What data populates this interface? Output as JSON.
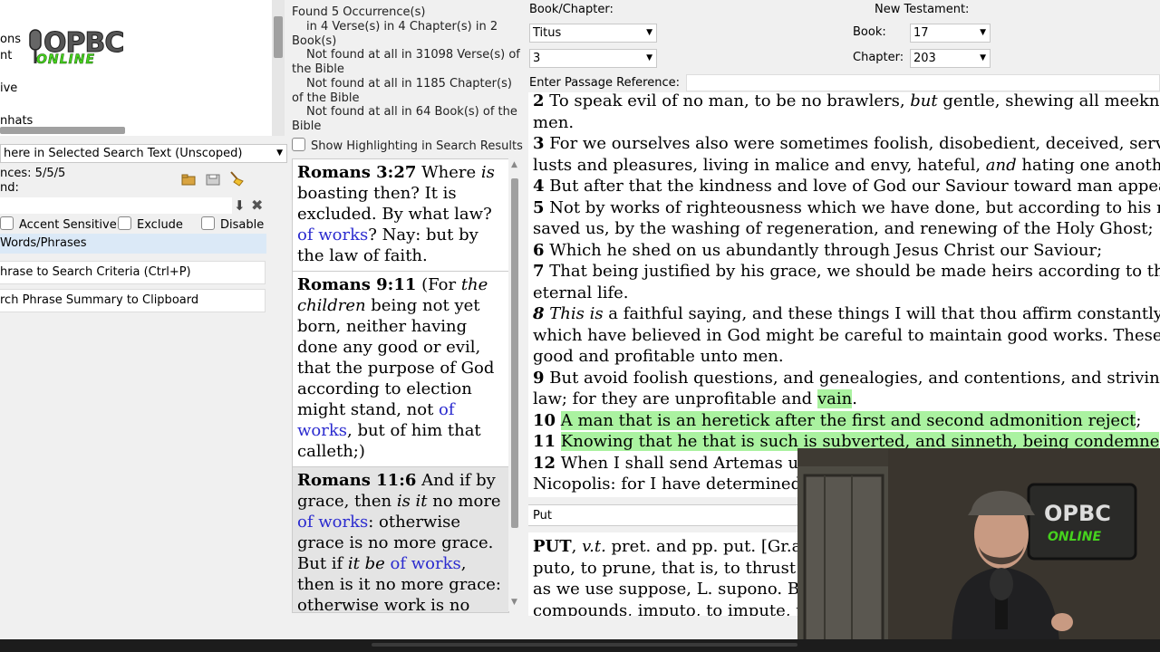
{
  "left_panel": {
    "tree_items": [
      "ons",
      "nt",
      "ive",
      "nhats"
    ],
    "logo": {
      "top": "OPBC",
      "bottom": "ONLINE"
    },
    "scope_select": "here in Selected Search Text (Unscoped)",
    "occurrences_label": "nces: 5/5/5",
    "found_label": "nd:",
    "options": {
      "accent": "Accent Sensitive",
      "exclude": "Exclude",
      "disable": "Disable"
    },
    "words_phrases": "Words/Phrases",
    "add_phrase_button": "hrase to Search Criteria (Ctrl+P)",
    "copy_summary_button": "rch Phrase Summary to Clipboard"
  },
  "search_info": {
    "line1": "Found 5 Occurrence(s)",
    "line2": "in 4 Verse(s) in 4 Chapter(s) in 2 Book(s)",
    "line3": "Not found at all in 31098 Verse(s) of the Bible",
    "line4": "Not found at all in 1185 Chapter(s) of the Bible",
    "line5": "Not found at all in 64 Book(s) of the Bible",
    "highlight_option": "Show Highlighting in Search Results"
  },
  "results": [
    {
      "ref": "Romans 3:27",
      "parts": [
        [
          "n",
          " Where "
        ],
        [
          "i",
          "is"
        ],
        [
          "n",
          " boasting then? It is excluded. By what law? "
        ],
        [
          "b",
          "of works"
        ],
        [
          "n",
          "? Nay: but by the law of faith."
        ]
      ]
    },
    {
      "ref": "Romans 9:11",
      "parts": [
        [
          "n",
          " (For "
        ],
        [
          "i",
          "the children"
        ],
        [
          "n",
          " being not yet born, neither having done any good or evil, that the purpose of God according to election might stand, not "
        ],
        [
          "b",
          "of works"
        ],
        [
          "n",
          ", but of him that calleth;)"
        ]
      ]
    },
    {
      "ref": "Romans 11:6",
      "selected": true,
      "parts": [
        [
          "n",
          " And if by grace, then "
        ],
        [
          "i",
          "is it"
        ],
        [
          "n",
          " no more "
        ],
        [
          "b",
          "of works"
        ],
        [
          "n",
          ": otherwise grace is no more grace. But if "
        ],
        [
          "i",
          "it be"
        ],
        [
          "n",
          " "
        ],
        [
          "b",
          "of works"
        ],
        [
          "n",
          ", then is it no more grace: otherwise work is no"
        ]
      ]
    }
  ],
  "navigation": {
    "book_chapter_label": "Book/Chapter:",
    "book_value": "Titus",
    "chapter_value": "3",
    "testament_label": "New Testament:",
    "book_label": "Book:",
    "book_num": "17",
    "chapter_label": "Chapter:",
    "chapter_num": "203",
    "passage_label": "Enter Passage Reference:"
  },
  "bible_lines": [
    [
      [
        "v",
        "2"
      ],
      [
        "n",
        " To speak evil of no man, to be no brawlers, "
      ],
      [
        "i",
        "but"
      ],
      [
        "n",
        " gentle, shewing all meekn"
      ]
    ],
    [
      [
        "n",
        "men."
      ]
    ],
    [
      [
        "v",
        "3"
      ],
      [
        "n",
        " For we ourselves also were sometimes foolish, disobedient, deceived, serv"
      ]
    ],
    [
      [
        "n",
        "lusts and pleasures, living in malice and envy, hateful, "
      ],
      [
        "i",
        "and"
      ],
      [
        "n",
        " hating one anoth"
      ]
    ],
    [
      [
        "v",
        "4"
      ],
      [
        "n",
        " But after that the kindness and love of God our Saviour toward man appea"
      ]
    ],
    [
      [
        "v",
        "5"
      ],
      [
        "n",
        " Not by works of righteousness which we have done, but according to his r"
      ]
    ],
    [
      [
        "n",
        "saved us, by the washing of regeneration, and renewing of the Holy Ghost;"
      ]
    ],
    [
      [
        "v",
        "6"
      ],
      [
        "n",
        " Which he shed on us abundantly through Jesus Christ our Saviour;"
      ]
    ],
    [
      [
        "v",
        "7"
      ],
      [
        "n",
        " That being justified by his grace, we should be made heirs according to th"
      ]
    ],
    [
      [
        "n",
        "eternal life."
      ]
    ],
    [
      [
        "vi",
        "8"
      ],
      [
        "i",
        " This is"
      ],
      [
        "n",
        " a faithful saying, and these things I will that thou affirm constantly"
      ]
    ],
    [
      [
        "n",
        "which have believed in God might be careful to maintain good works. These"
      ]
    ],
    [
      [
        "n",
        "good and profitable unto men."
      ]
    ],
    [
      [
        "v",
        "9"
      ],
      [
        "n",
        " But avoid foolish questions, and genealogies, and contentions, and strivin"
      ]
    ],
    [
      [
        "n",
        "law; for they are unprofitable and "
      ],
      [
        "h",
        "vain"
      ],
      [
        "n",
        "."
      ]
    ],
    [
      [
        "v",
        "10"
      ],
      [
        "n",
        " "
      ],
      [
        "h",
        "A man that is an heretick after the first and second admonition reject"
      ],
      [
        "n",
        ";"
      ]
    ],
    [
      [
        "v",
        "11"
      ],
      [
        "n",
        " "
      ],
      [
        "h",
        "Knowing that he that is such is subverted, and sinneth, being condemne"
      ]
    ],
    [
      [
        "v",
        "12"
      ],
      [
        "n",
        " When I shall send Artemas u"
      ]
    ],
    [
      [
        "n",
        "Nicopolis: for I have determined"
      ]
    ]
  ],
  "dictionary": {
    "header": "Put",
    "lines": [
      [
        [
          "b",
          "PUT"
        ],
        [
          "n",
          ", "
        ],
        [
          "i",
          "v.t."
        ],
        [
          "n",
          " pret. and pp. put. [Gr.a"
        ]
      ],
      [
        [
          "n",
          "puto, to prune, that is, to thrust"
        ]
      ],
      [
        [
          "n",
          "as we use suppose, L. supono. B"
        ]
      ],
      [
        [
          "n",
          "compounds, imputo, to impute, t"
        ]
      ]
    ]
  },
  "video_overlay": {
    "logo_top": "OPBC",
    "logo_bottom": "ONLINE"
  },
  "colors": {
    "highlight": "#aaf2a0",
    "link": "#2b2bcf",
    "selected_bg": "#e4e4e4"
  }
}
